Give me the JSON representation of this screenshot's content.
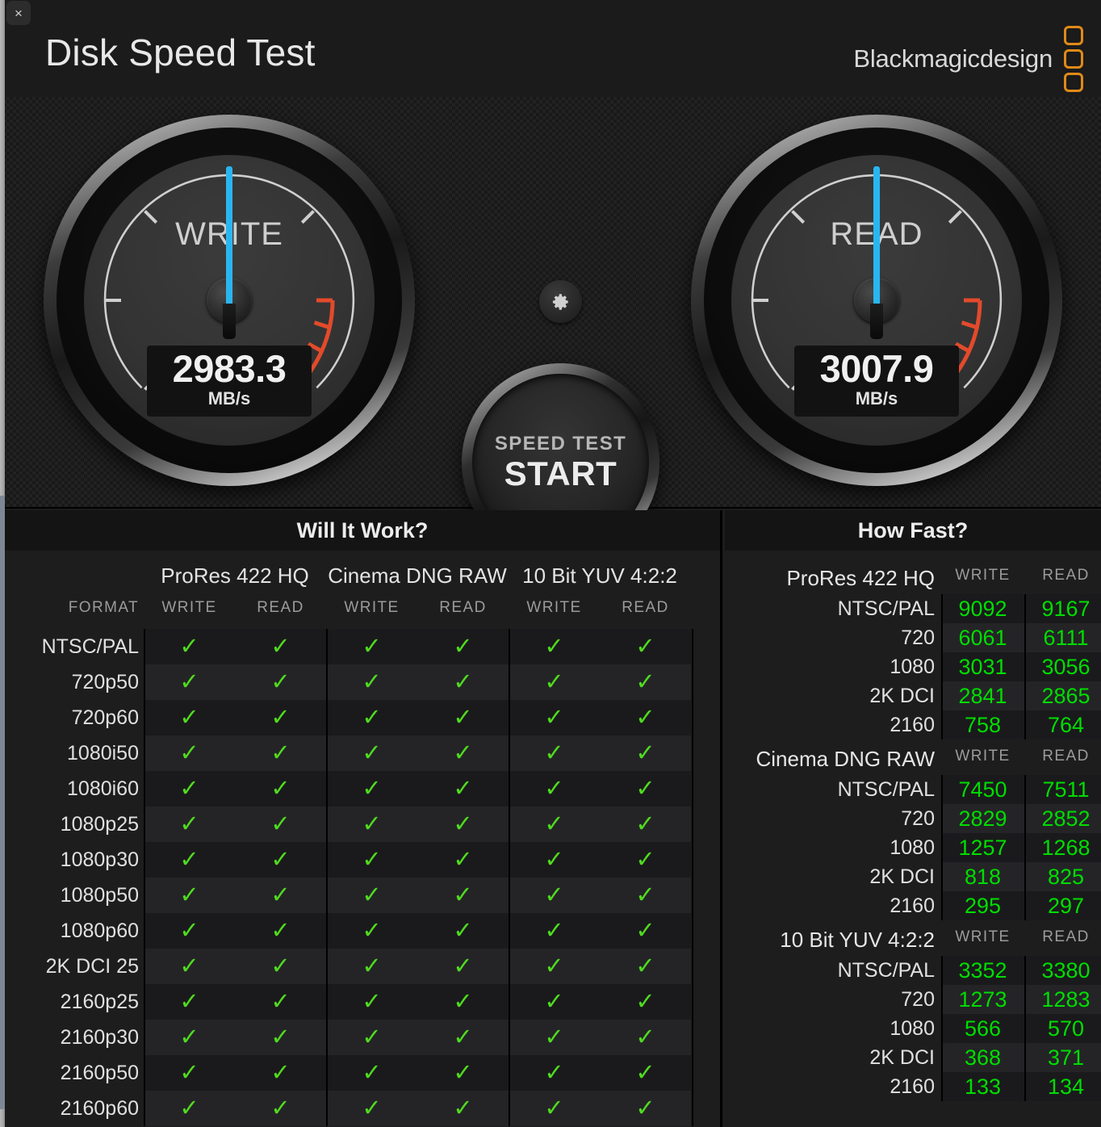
{
  "window": {
    "close_label": "×",
    "title": "Disk Speed Test",
    "brand": "Blackmagicdesign",
    "brand_color": "#e08a18"
  },
  "gauges": {
    "write": {
      "label": "WRITE",
      "value": "2983.3",
      "unit": "MB/s",
      "needle_color": "#29b6f0"
    },
    "read": {
      "label": "READ",
      "value": "3007.9",
      "unit": "MB/s",
      "needle_color": "#29b6f0"
    }
  },
  "controls": {
    "gear_icon": "gear-icon",
    "start_small": "SPEED TEST",
    "start_big": "START"
  },
  "will_it_work": {
    "title": "Will It Work?",
    "format_header": "FORMAT",
    "groups": [
      "ProRes 422 HQ",
      "Cinema DNG RAW",
      "10 Bit YUV 4:2:2"
    ],
    "sub_headers": [
      "WRITE",
      "READ",
      "WRITE",
      "READ",
      "WRITE",
      "READ"
    ],
    "check_glyph": "✓",
    "check_color": "#4fdb1e",
    "rows": [
      {
        "format": "NTSC/PAL",
        "cells": [
          "✓",
          "✓",
          "✓",
          "✓",
          "✓",
          "✓"
        ]
      },
      {
        "format": "720p50",
        "cells": [
          "✓",
          "✓",
          "✓",
          "✓",
          "✓",
          "✓"
        ]
      },
      {
        "format": "720p60",
        "cells": [
          "✓",
          "✓",
          "✓",
          "✓",
          "✓",
          "✓"
        ]
      },
      {
        "format": "1080i50",
        "cells": [
          "✓",
          "✓",
          "✓",
          "✓",
          "✓",
          "✓"
        ]
      },
      {
        "format": "1080i60",
        "cells": [
          "✓",
          "✓",
          "✓",
          "✓",
          "✓",
          "✓"
        ]
      },
      {
        "format": "1080p25",
        "cells": [
          "✓",
          "✓",
          "✓",
          "✓",
          "✓",
          "✓"
        ]
      },
      {
        "format": "1080p30",
        "cells": [
          "✓",
          "✓",
          "✓",
          "✓",
          "✓",
          "✓"
        ]
      },
      {
        "format": "1080p50",
        "cells": [
          "✓",
          "✓",
          "✓",
          "✓",
          "✓",
          "✓"
        ]
      },
      {
        "format": "1080p60",
        "cells": [
          "✓",
          "✓",
          "✓",
          "✓",
          "✓",
          "✓"
        ]
      },
      {
        "format": "2K DCI 25",
        "cells": [
          "✓",
          "✓",
          "✓",
          "✓",
          "✓",
          "✓"
        ]
      },
      {
        "format": "2160p25",
        "cells": [
          "✓",
          "✓",
          "✓",
          "✓",
          "✓",
          "✓"
        ]
      },
      {
        "format": "2160p30",
        "cells": [
          "✓",
          "✓",
          "✓",
          "✓",
          "✓",
          "✓"
        ]
      },
      {
        "format": "2160p50",
        "cells": [
          "✓",
          "✓",
          "✓",
          "✓",
          "✓",
          "✓"
        ]
      },
      {
        "format": "2160p60",
        "cells": [
          "✓",
          "✓",
          "✓",
          "✓",
          "✓",
          "✓"
        ]
      }
    ]
  },
  "how_fast": {
    "title": "How Fast?",
    "value_color": "#00dd00",
    "col_write": "WRITE",
    "col_read": "READ",
    "sections": [
      {
        "name": "ProRes 422 HQ",
        "rows": [
          {
            "label": "NTSC/PAL",
            "write": "9092",
            "read": "9167"
          },
          {
            "label": "720",
            "write": "6061",
            "read": "6111"
          },
          {
            "label": "1080",
            "write": "3031",
            "read": "3056"
          },
          {
            "label": "2K DCI",
            "write": "2841",
            "read": "2865"
          },
          {
            "label": "2160",
            "write": "758",
            "read": "764"
          }
        ]
      },
      {
        "name": "Cinema DNG RAW",
        "rows": [
          {
            "label": "NTSC/PAL",
            "write": "7450",
            "read": "7511"
          },
          {
            "label": "720",
            "write": "2829",
            "read": "2852"
          },
          {
            "label": "1080",
            "write": "1257",
            "read": "1268"
          },
          {
            "label": "2K DCI",
            "write": "818",
            "read": "825"
          },
          {
            "label": "2160",
            "write": "295",
            "read": "297"
          }
        ]
      },
      {
        "name": "10 Bit YUV 4:2:2",
        "rows": [
          {
            "label": "NTSC/PAL",
            "write": "3352",
            "read": "3380"
          },
          {
            "label": "720",
            "write": "1273",
            "read": "1283"
          },
          {
            "label": "1080",
            "write": "566",
            "read": "570"
          },
          {
            "label": "2K DCI",
            "write": "368",
            "read": "371"
          },
          {
            "label": "2160",
            "write": "133",
            "read": "134"
          }
        ]
      }
    ]
  }
}
